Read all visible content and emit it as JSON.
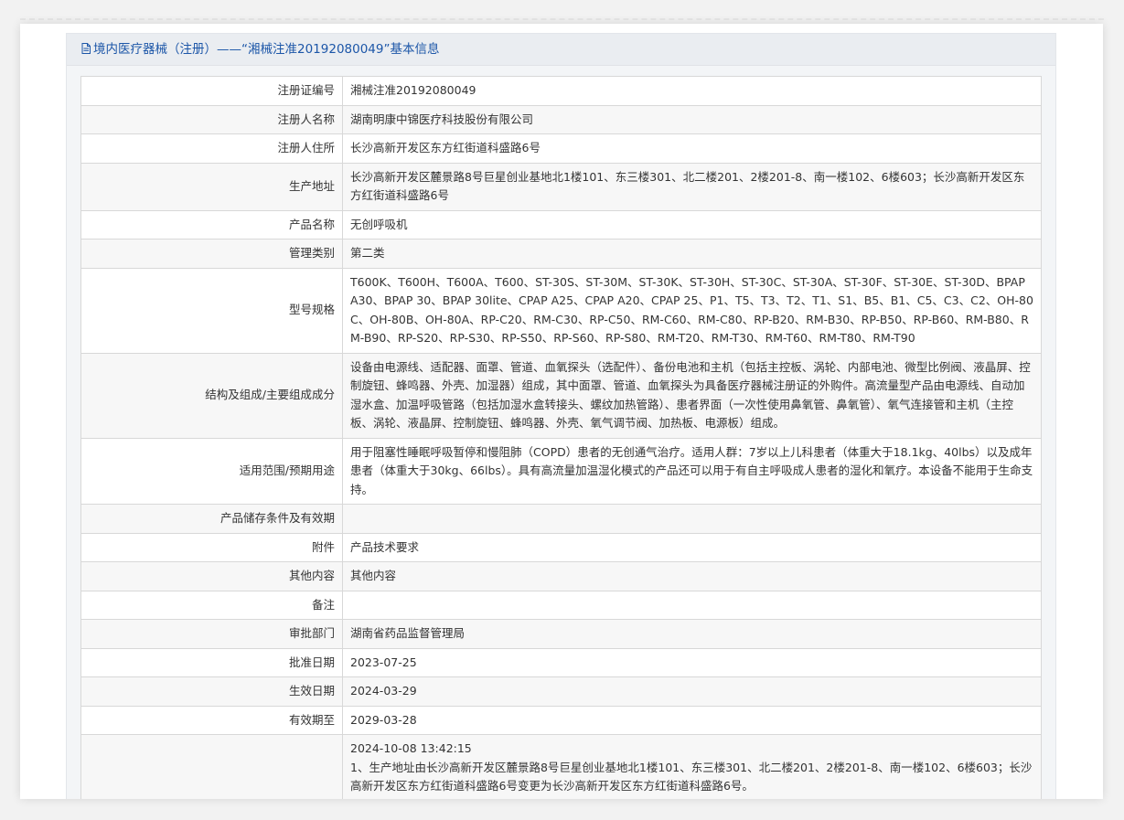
{
  "header": {
    "title": "境内医疗器械（注册）——“湘械注准20192080049”基本信息",
    "icon": "document-icon",
    "color": "#1c56a8"
  },
  "rows": [
    {
      "label": "注册证编号",
      "value": "湘械注准20192080049"
    },
    {
      "label": "注册人名称",
      "value": "湖南明康中锦医疗科技股份有限公司"
    },
    {
      "label": "注册人住所",
      "value": "长沙高新开发区东方红街道科盛路6号"
    },
    {
      "label": "生产地址",
      "value": "长沙高新开发区麓景路8号巨星创业基地北1楼101、东三楼301、北二楼201、2楼201-8、南一楼102、6楼603；长沙高新开发区东方红街道科盛路6号"
    },
    {
      "label": "产品名称",
      "value": "无创呼吸机"
    },
    {
      "label": "管理类别",
      "value": "第二类"
    },
    {
      "label": "型号规格",
      "value": "T600K、T600H、T600A、T600、ST-30S、ST-30M、ST-30K、ST-30H、ST-30C、ST-30A、ST-30F、ST-30E、ST-30D、BPAP A30、BPAP 30、BPAP 30lite、CPAP A25、CPAP A20、CPAP 25、P1、T5、T3、T2、T1、S1、B5、B1、C5、C3、C2、OH-80C、OH-80B、OH-80A、RP-C20、RM-C30、RP-C50、RM-C60、RM-C80、RP-B20、RM-B30、RP-B50、RP-B60、RM-B80、RM-B90、RP-S20、RP-S30、RP-S50、RP-S60、RP-S80、RM-T20、RM-T30、RM-T60、RM-T80、RM-T90"
    },
    {
      "label": "结构及组成/主要组成成分",
      "value": "设备由电源线、适配器、面罩、管道、血氧探头（选配件）、备份电池和主机（包括主控板、涡轮、内部电池、微型比例阀、液晶屏、控制旋钮、蜂鸣器、外壳、加湿器）组成，其中面罩、管道、血氧探头为具备医疗器械注册证的外购件。高流量型产品由电源线、自动加湿水盒、加温呼吸管路（包括加湿水盒转接头、螺纹加热管路）、患者界面（一次性使用鼻氧管、鼻氧管）、氧气连接管和主机（主控板、涡轮、液晶屏、控制旋钮、蜂鸣器、外壳、氧气调节阀、加热板、电源板）组成。"
    },
    {
      "label": "适用范围/预期用途",
      "value": "用于阻塞性睡眠呼吸暂停和慢阻肺（COPD）患者的无创通气治疗。适用人群：7岁以上儿科患者（体重大于18.1kg、40lbs）以及成年患者（体重大于30kg、66lbs）。具有高流量加温湿化模式的产品还可以用于有自主呼吸成人患者的湿化和氧疗。本设备不能用于生命支持。"
    },
    {
      "label": "产品储存条件及有效期",
      "value": ""
    },
    {
      "label": "附件",
      "value": "产品技术要求"
    },
    {
      "label": "其他内容",
      "value": "其他内容"
    },
    {
      "label": "备注",
      "value": ""
    },
    {
      "label": "审批部门",
      "value": "湖南省药品监督管理局"
    },
    {
      "label": "批准日期",
      "value": "2023-07-25"
    },
    {
      "label": "生效日期",
      "value": "2024-03-29"
    },
    {
      "label": "有效期至",
      "value": "2029-03-28"
    }
  ],
  "change": {
    "label": "",
    "timestamp": "2024-10-08 13:42:15",
    "text": "1、生产地址由长沙高新开发区麓景路8号巨星创业基地北1楼101、东三楼301、北二楼201、2楼201-8、南一楼102、6楼603；长沙高新开发区东方红街道科盛路6号变更为长沙高新开发区东方红街道科盛路6号。"
  }
}
